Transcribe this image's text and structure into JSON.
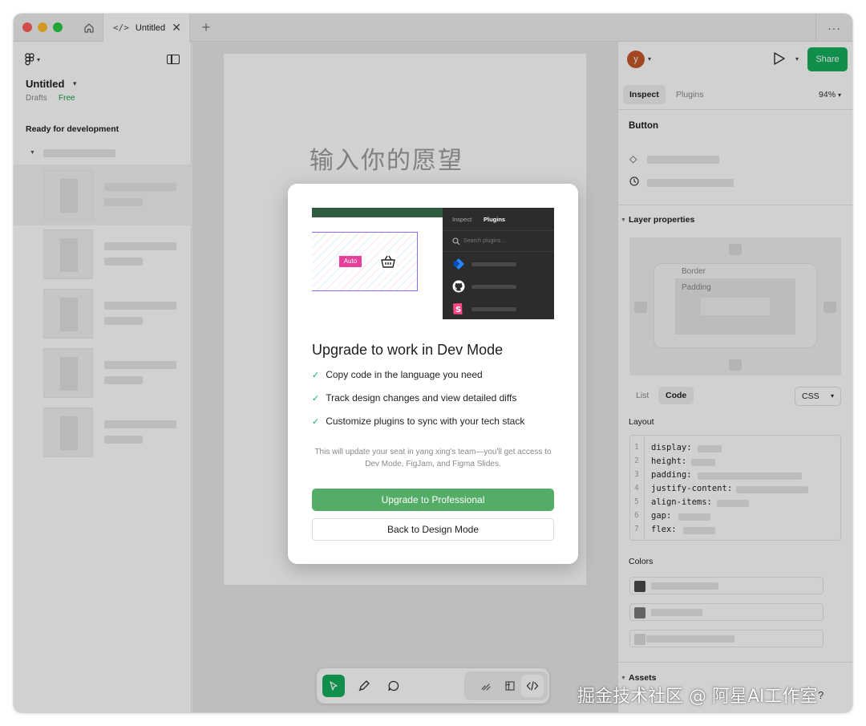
{
  "titlebar": {
    "tab_title": "Untitled",
    "tab_icon": "code-icon",
    "tab_code_glyph": "</>",
    "close_glyph": "✕",
    "plus_glyph": "+",
    "more_glyph": "···"
  },
  "left_panel": {
    "file_title": "Untitled",
    "file_location": "Drafts",
    "plan": "Free",
    "section_label": "Ready for development"
  },
  "canvas": {
    "placeholder_text": "输入你的愿望"
  },
  "right_panel": {
    "avatar_letter": "y",
    "share_label": "Share",
    "tabs": [
      {
        "label": "Inspect",
        "active": true
      },
      {
        "label": "Plugins",
        "active": false
      }
    ],
    "zoom": "94%",
    "selection_title": "Button",
    "layer_properties_label": "Layer properties",
    "border_label": "Border",
    "padding_label": "Padding",
    "view_tabs": [
      {
        "label": "List",
        "active": false
      },
      {
        "label": "Code",
        "active": true
      }
    ],
    "language": "CSS",
    "layout_label": "Layout",
    "code_lines": [
      {
        "num": "1",
        "prop": "display:"
      },
      {
        "num": "2",
        "prop": "height:"
      },
      {
        "num": "3",
        "prop": "padding:"
      },
      {
        "num": "4",
        "prop": "justify-content:"
      },
      {
        "num": "5",
        "prop": "align-items:"
      },
      {
        "num": "6",
        "prop": "gap:"
      },
      {
        "num": "7",
        "prop": "flex:"
      }
    ],
    "colors_label": "Colors",
    "assets_label": "Assets",
    "help_glyph": "?"
  },
  "modal": {
    "illustration": {
      "tab_inspect": "Inspect",
      "tab_plugins": "Plugins",
      "search_placeholder": "Search plugins...",
      "auto_tag": "Auto"
    },
    "title": "Upgrade to work in Dev Mode",
    "features": [
      "Copy code in the language you need",
      "Track design changes and view detailed diffs",
      "Customize plugins to sync with your tech stack"
    ],
    "seat_note": "This will update your seat in yang xing's team—you'll get access to Dev Mode, FigJam, and Figma Slides.",
    "primary_button": "Upgrade to Professional",
    "secondary_button": "Back to Design Mode"
  },
  "watermark": "掘金技术社区 @ 阿星AI工作室",
  "colors": {
    "accent_green": "#14ae5c",
    "upgrade_green": "#54ad66",
    "illustration_green": "#2f5b3e",
    "plugin_panel": "#2c2c2c",
    "auto_pink": "#e83e9c",
    "frame_purple": "#8b67ff"
  }
}
